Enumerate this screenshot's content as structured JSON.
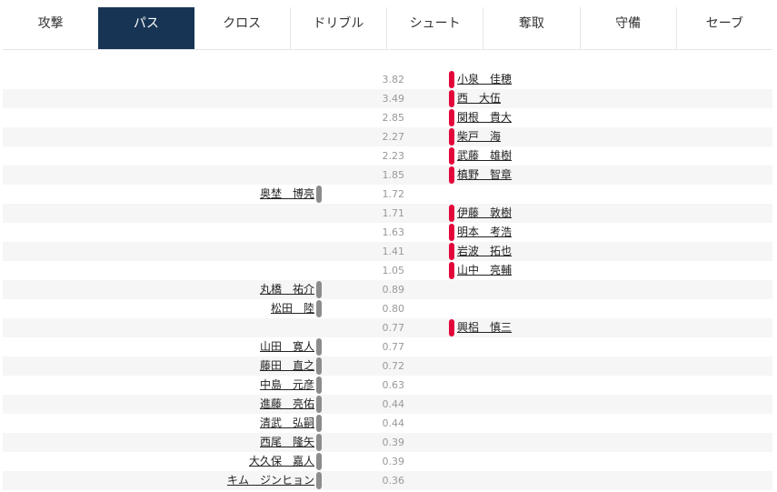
{
  "tabs": [
    {
      "label": "攻撃",
      "active": false
    },
    {
      "label": "パス",
      "active": true
    },
    {
      "label": "クロス",
      "active": false
    },
    {
      "label": "ドリブル",
      "active": false
    },
    {
      "label": "シュート",
      "active": false
    },
    {
      "label": "奪取",
      "active": false
    },
    {
      "label": "守備",
      "active": false
    },
    {
      "label": "セーブ",
      "active": false
    }
  ],
  "colors": {
    "active_tab": "#173454",
    "home_bar": "#8c8c8c",
    "away_bar": "#e3063a",
    "stripe": "#f6f6f6"
  },
  "rows": [
    {
      "value": "3.82",
      "side": "right",
      "name": "小泉　佳穂"
    },
    {
      "value": "3.49",
      "side": "right",
      "name": "西　大伍"
    },
    {
      "value": "2.85",
      "side": "right",
      "name": "関根　貴大"
    },
    {
      "value": "2.27",
      "side": "right",
      "name": "柴戸　海"
    },
    {
      "value": "2.23",
      "side": "right",
      "name": "武藤　雄樹"
    },
    {
      "value": "1.85",
      "side": "right",
      "name": "槙野　智章"
    },
    {
      "value": "1.72",
      "side": "left",
      "name": "奥埜　博亮"
    },
    {
      "value": "1.71",
      "side": "right",
      "name": "伊藤　敦樹"
    },
    {
      "value": "1.63",
      "side": "right",
      "name": "明本　考浩"
    },
    {
      "value": "1.41",
      "side": "right",
      "name": "岩波　拓也"
    },
    {
      "value": "1.05",
      "side": "right",
      "name": "山中　亮輔"
    },
    {
      "value": "0.89",
      "side": "left",
      "name": "丸橋　祐介"
    },
    {
      "value": "0.80",
      "side": "left",
      "name": "松田　陸"
    },
    {
      "value": "0.77",
      "side": "right",
      "name": "興梠　慎三"
    },
    {
      "value": "0.77",
      "side": "left",
      "name": "山田　寛人"
    },
    {
      "value": "0.72",
      "side": "left",
      "name": "藤田　直之"
    },
    {
      "value": "0.63",
      "side": "left",
      "name": "中島　元彦"
    },
    {
      "value": "0.44",
      "side": "left",
      "name": "進藤　亮佑"
    },
    {
      "value": "0.44",
      "side": "left",
      "name": "清武　弘嗣"
    },
    {
      "value": "0.39",
      "side": "left",
      "name": "西尾　隆矢"
    },
    {
      "value": "0.39",
      "side": "left",
      "name": "大久保　嘉人"
    },
    {
      "value": "0.36",
      "side": "left",
      "name": "キム　ジンヒョン"
    }
  ]
}
